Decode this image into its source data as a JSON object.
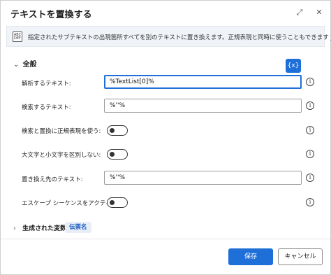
{
  "dialog": {
    "title": "テキストを置換する",
    "expand_glyph": "⤢",
    "close_glyph": "✕"
  },
  "banner": {
    "icon_text": "ABC\nDEF",
    "text": "指定されたサブテキストの出現箇所すべてを別のテキストに置き換えます。正規表現と同時に使うこともできます",
    "link": "詳細"
  },
  "section": {
    "title": "全般",
    "chevron": "⌄"
  },
  "variable_button": "{x}",
  "fields": {
    "text_to_parse": {
      "label": "解析するテキスト:",
      "value": "%TextList[0]%"
    },
    "search_text": {
      "label": "検索するテキスト:",
      "value": "%''%"
    },
    "use_regex": {
      "label": "検索と置換に正規表現を使う:",
      "on": false
    },
    "ignore_case": {
      "label": "大文字と小文字を区別しない:",
      "on": false
    },
    "replace_with": {
      "label": "置き換え先のテキスト:",
      "value": "%''%"
    },
    "escape_sequences": {
      "label": "エスケープ シーケンスをアクティブ化:",
      "on": false
    }
  },
  "info_glyph": "i",
  "generated": {
    "chevron": "›",
    "label": "生成された変数",
    "badge": "伝票名"
  },
  "buttons": {
    "save": "保存",
    "cancel": "キャンセル"
  }
}
